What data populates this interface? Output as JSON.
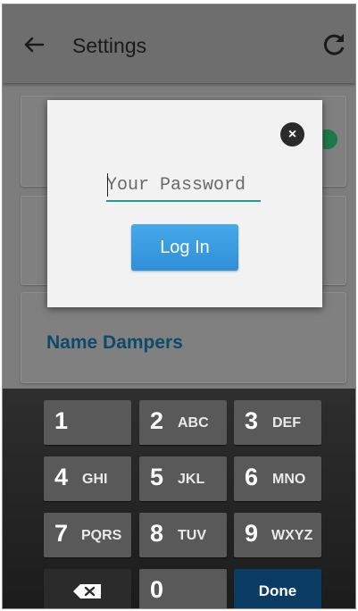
{
  "appbar": {
    "title": "Settings",
    "back_icon": "arrow-left-icon",
    "refresh_icon": "refresh-icon"
  },
  "cards": {
    "name_dampers_label": "Name Dampers"
  },
  "dialog": {
    "password_placeholder": "Your Password",
    "login_label": "Log In",
    "close_icon": "close-icon"
  },
  "keyboard": {
    "keys": [
      {
        "num": "1",
        "letters": ""
      },
      {
        "num": "2",
        "letters": "ABC"
      },
      {
        "num": "3",
        "letters": "DEF"
      },
      {
        "num": "4",
        "letters": "GHI"
      },
      {
        "num": "5",
        "letters": "JKL"
      },
      {
        "num": "6",
        "letters": "MNO"
      },
      {
        "num": "7",
        "letters": "PQRS"
      },
      {
        "num": "8",
        "letters": "TUV"
      },
      {
        "num": "9",
        "letters": "WXYZ"
      }
    ],
    "zero": "0",
    "done": "Done",
    "backspace_icon": "backspace-icon"
  },
  "colors": {
    "accent": "#2f8fd8",
    "underline": "#1f9b8f",
    "done_key": "#0b3c63",
    "toggle": "#1c7a4a"
  }
}
